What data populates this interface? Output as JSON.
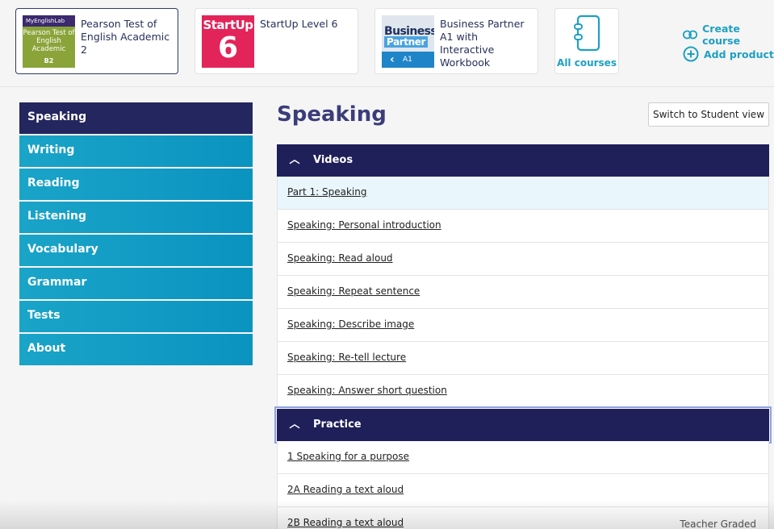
{
  "courses": [
    {
      "title": "Pearson Test of English Academic 2",
      "thumb_band": "MyEnglishLab",
      "thumb_text": "Pearson Test of English Academic",
      "thumb_level": "B2"
    },
    {
      "title": "StartUp Level 6",
      "thumb_word": "StartUp",
      "thumb_number": "6"
    },
    {
      "title": "Business Partner A1 with Interactive Workbook",
      "thumb_word1": "Business",
      "thumb_word2": "Partner",
      "thumb_level": "A1"
    }
  ],
  "all_courses_label": "All courses",
  "create_course_label": "Create course",
  "add_product_label": "Add product",
  "sidebar": {
    "items": [
      {
        "label": "Speaking"
      },
      {
        "label": "Writing"
      },
      {
        "label": "Reading"
      },
      {
        "label": "Listening"
      },
      {
        "label": "Vocabulary"
      },
      {
        "label": "Grammar"
      },
      {
        "label": "Tests"
      },
      {
        "label": "About"
      }
    ]
  },
  "main": {
    "title": "Speaking",
    "switch_button": "Switch to Student view",
    "sections": [
      {
        "title": "Videos",
        "items": [
          {
            "label": "Part 1: Speaking"
          },
          {
            "label": "Speaking: Personal introduction"
          },
          {
            "label": "Speaking: Read aloud"
          },
          {
            "label": "Speaking: Repeat sentence"
          },
          {
            "label": "Speaking: Describe image"
          },
          {
            "label": "Speaking: Re-tell lecture"
          },
          {
            "label": "Speaking: Answer short question"
          }
        ]
      },
      {
        "title": "Practice",
        "items": [
          {
            "label": "1 Speaking for a purpose"
          },
          {
            "label": "2A Reading a text aloud"
          },
          {
            "label": "2B Reading a text aloud",
            "tag": "Teacher Graded"
          }
        ]
      }
    ]
  },
  "colors": {
    "navy": "#1f1f5a",
    "teal": "#1aa4c8",
    "link_blue": "#1ea0c3",
    "title_purple": "#3b3d7a"
  }
}
